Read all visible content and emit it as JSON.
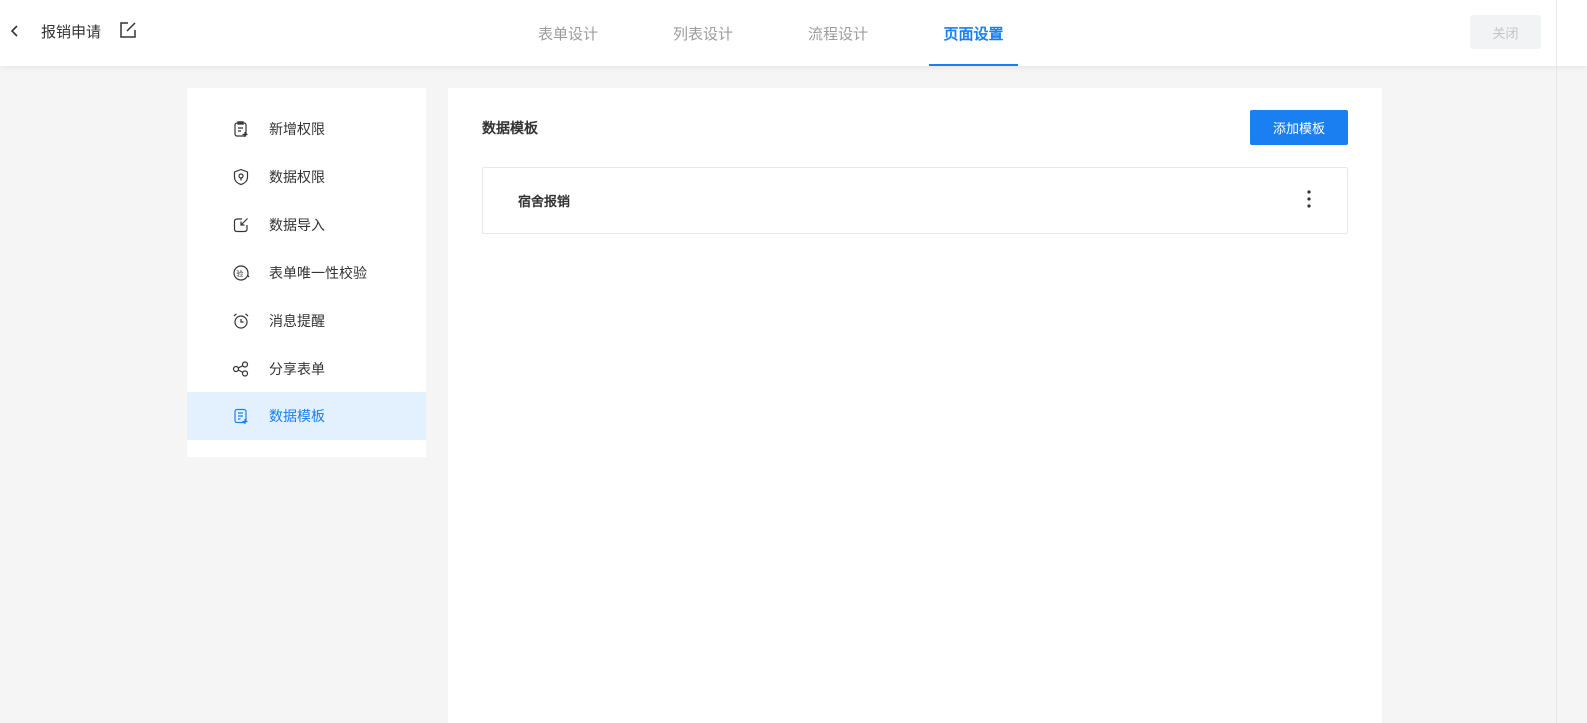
{
  "header": {
    "app_title": "报销申请",
    "tabs": [
      {
        "label": "表单设计"
      },
      {
        "label": "列表设计"
      },
      {
        "label": "流程设计"
      },
      {
        "label": "页面设置",
        "active": true
      }
    ],
    "close_label": "关闭"
  },
  "sidebar": {
    "items": [
      {
        "label": "新增权限",
        "icon": "add-permission-icon"
      },
      {
        "label": "数据权限",
        "icon": "data-permission-icon"
      },
      {
        "label": "数据导入",
        "icon": "data-import-icon"
      },
      {
        "label": "表单唯一性校验",
        "icon": "uniqueness-check-icon"
      },
      {
        "label": "消息提醒",
        "icon": "alarm-clock-icon"
      },
      {
        "label": "分享表单",
        "icon": "share-icon"
      },
      {
        "label": "数据模板",
        "icon": "data-template-icon",
        "active": true
      }
    ]
  },
  "main": {
    "title": "数据模板",
    "add_button_label": "添加模板",
    "templates": [
      {
        "name": "宿舍报销"
      }
    ]
  },
  "colors": {
    "accent": "#1a7ff0",
    "active_bg": "#e3f1fe",
    "page_bg": "#f5f5f5"
  }
}
